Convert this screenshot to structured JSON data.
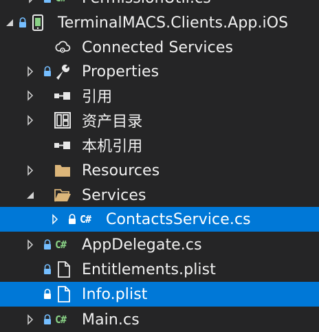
{
  "solution_explorer": {
    "partial_item": {
      "label": "PermissionUtil.cs"
    },
    "project": {
      "label": "TerminalMACS.Clients.App.iOS"
    },
    "items": [
      {
        "label": "Connected Services",
        "icon": "cloud-gear-icon"
      },
      {
        "label": "Properties",
        "icon": "wrench-icon"
      },
      {
        "label": "引用",
        "icon": "references-icon"
      },
      {
        "label": "资产目录",
        "icon": "asset-catalog-icon"
      },
      {
        "label": "本机引用",
        "icon": "native-references-icon"
      },
      {
        "label": "Resources",
        "icon": "folder-icon"
      },
      {
        "label": "Services",
        "icon": "folder-open-icon"
      },
      {
        "label": "ContactsService.cs",
        "icon": "csharp-file-icon"
      },
      {
        "label": "AppDelegate.cs",
        "icon": "csharp-file-icon"
      },
      {
        "label": "Entitlements.plist",
        "icon": "file-icon"
      },
      {
        "label": "Info.plist",
        "icon": "file-icon"
      },
      {
        "label": "Main.cs",
        "icon": "csharp-file-icon"
      }
    ],
    "colors": {
      "background": "#252526",
      "selected_active": "#0078d7",
      "selected_inactive": "#094771",
      "text": "#f1f1f1",
      "csharp_accent": "#89d185",
      "lock_accent": "#75beff",
      "folder": "#dcb67a"
    }
  }
}
